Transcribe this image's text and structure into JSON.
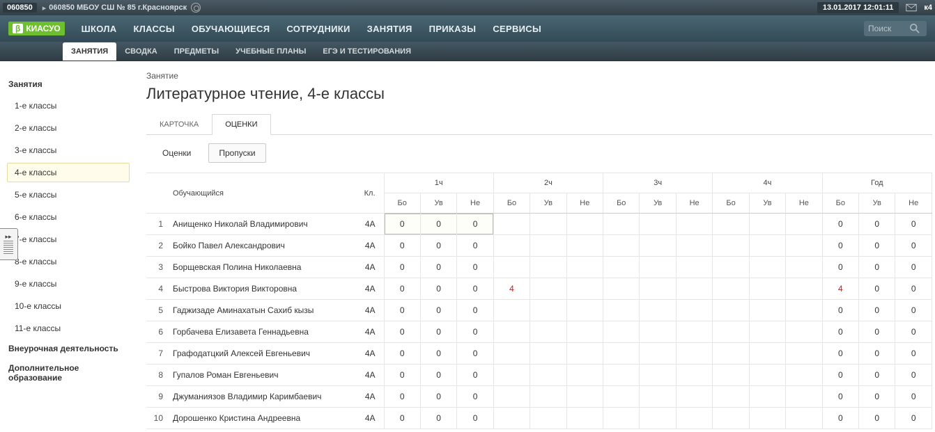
{
  "topbar": {
    "code": "060850",
    "school": "060850 МБОУ СШ № 85 г.Красноярск",
    "datetime": "13.01.2017 12:01:11",
    "user": "к4"
  },
  "logo": {
    "badge": "β",
    "text": "КИАСУО"
  },
  "mainnav": {
    "items": [
      "ШКОЛА",
      "КЛАССЫ",
      "ОБУЧАЮЩИЕСЯ",
      "СОТРУДНИКИ",
      "ЗАНЯТИЯ",
      "ПРИКАЗЫ",
      "СЕРВИСЫ"
    ]
  },
  "search": {
    "placeholder": "Поиск"
  },
  "subnav": {
    "items": [
      "ЗАНЯТИЯ",
      "СВОДКА",
      "ПРЕДМЕТЫ",
      "УЧЕБНЫЕ ПЛАНЫ",
      "ЕГЭ И ТЕСТИРОВАНИЯ"
    ],
    "active": 0
  },
  "sidebar": {
    "title1": "Занятия",
    "classes": [
      "1-е классы",
      "2-е классы",
      "3-е классы",
      "4-е классы",
      "5-е классы",
      "6-е классы",
      "7-е классы",
      "8-е классы",
      "9-е классы",
      "10-е классы",
      "11-е классы"
    ],
    "active": 3,
    "title2": "Внеурочная деятельность",
    "title3": "Дополнительное образование"
  },
  "content": {
    "crumb": "Занятие",
    "title": "Литературное чтение, 4-е классы",
    "tabs": [
      "КАРТОЧКА",
      "ОЦЕНКИ"
    ],
    "tabs_active": 1,
    "subtabs": [
      "Оценки",
      "Пропуски"
    ],
    "subtabs_boxed": 1
  },
  "table": {
    "periods": [
      "1ч",
      "2ч",
      "3ч",
      "4ч",
      "Год"
    ],
    "sub_headers": [
      "Бо",
      "Ув",
      "Не"
    ],
    "student_col": "Обучающийся",
    "class_col": "Кл.",
    "rows": [
      {
        "n": 1,
        "name": "Анищенко Николай Владимирович",
        "kl": "4А",
        "p1": [
          0,
          0,
          0
        ],
        "p2": [
          "",
          "",
          ""
        ],
        "p3": [
          "",
          "",
          ""
        ],
        "p4": [
          "",
          "",
          ""
        ],
        "year": [
          0,
          0,
          0
        ],
        "hl": true
      },
      {
        "n": 2,
        "name": "Бойко Павел Александрович",
        "kl": "4А",
        "p1": [
          0,
          0,
          0
        ],
        "p2": [
          "",
          "",
          ""
        ],
        "p3": [
          "",
          "",
          ""
        ],
        "p4": [
          "",
          "",
          ""
        ],
        "year": [
          0,
          0,
          0
        ]
      },
      {
        "n": 3,
        "name": "Борщевская Полина Николаевна",
        "kl": "4А",
        "p1": [
          0,
          0,
          0
        ],
        "p2": [
          "",
          "",
          ""
        ],
        "p3": [
          "",
          "",
          ""
        ],
        "p4": [
          "",
          "",
          ""
        ],
        "year": [
          0,
          0,
          0
        ]
      },
      {
        "n": 4,
        "name": "Быстрова Виктория Викторовна",
        "kl": "4А",
        "p1": [
          0,
          0,
          0
        ],
        "p2": [
          4,
          "",
          ""
        ],
        "p3": [
          "",
          "",
          ""
        ],
        "p4": [
          "",
          "",
          ""
        ],
        "year": [
          4,
          0,
          0
        ],
        "red": [
          true
        ]
      },
      {
        "n": 5,
        "name": "Гаджизаде Аминахатын Сахиб кызы",
        "kl": "4А",
        "p1": [
          0,
          0,
          0
        ],
        "p2": [
          "",
          "",
          ""
        ],
        "p3": [
          "",
          "",
          ""
        ],
        "p4": [
          "",
          "",
          ""
        ],
        "year": [
          0,
          0,
          0
        ]
      },
      {
        "n": 6,
        "name": "Горбачева Елизавета Геннадьевна",
        "kl": "4А",
        "p1": [
          0,
          0,
          0
        ],
        "p2": [
          "",
          "",
          ""
        ],
        "p3": [
          "",
          "",
          ""
        ],
        "p4": [
          "",
          "",
          ""
        ],
        "year": [
          0,
          0,
          0
        ]
      },
      {
        "n": 7,
        "name": "Графодатцкий Алексей Евгеньевич",
        "kl": "4А",
        "p1": [
          0,
          0,
          0
        ],
        "p2": [
          "",
          "",
          ""
        ],
        "p3": [
          "",
          "",
          ""
        ],
        "p4": [
          "",
          "",
          ""
        ],
        "year": [
          0,
          0,
          0
        ]
      },
      {
        "n": 8,
        "name": "Гупалов Роман Евгеньевич",
        "kl": "4А",
        "p1": [
          0,
          0,
          0
        ],
        "p2": [
          "",
          "",
          ""
        ],
        "p3": [
          "",
          "",
          ""
        ],
        "p4": [
          "",
          "",
          ""
        ],
        "year": [
          0,
          0,
          0
        ]
      },
      {
        "n": 9,
        "name": "Джуманиязов Владимир Каримбаевич",
        "kl": "4А",
        "p1": [
          0,
          0,
          0
        ],
        "p2": [
          "",
          "",
          ""
        ],
        "p3": [
          "",
          "",
          ""
        ],
        "p4": [
          "",
          "",
          ""
        ],
        "year": [
          0,
          0,
          0
        ]
      },
      {
        "n": 10,
        "name": "Дорошенко Кристина Андреевна",
        "kl": "4А",
        "p1": [
          0,
          0,
          0
        ],
        "p2": [
          "",
          "",
          ""
        ],
        "p3": [
          "",
          "",
          ""
        ],
        "p4": [
          "",
          "",
          ""
        ],
        "year": [
          0,
          0,
          0
        ]
      }
    ]
  }
}
